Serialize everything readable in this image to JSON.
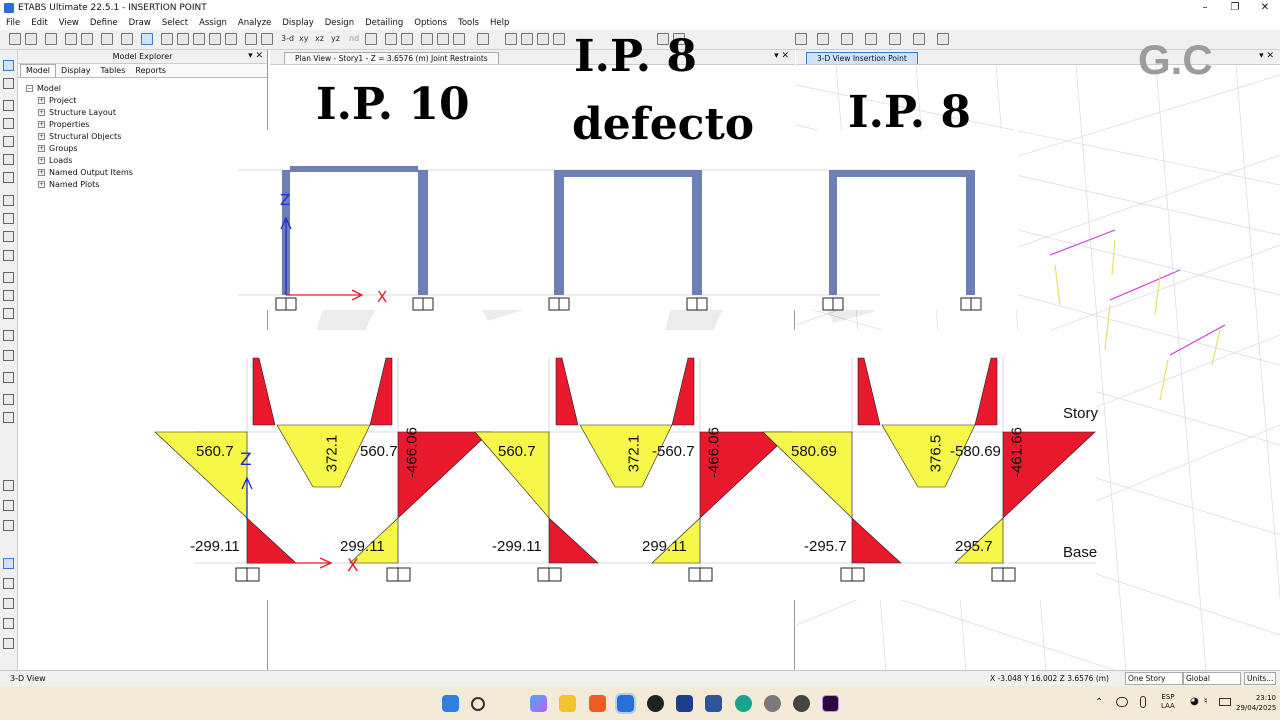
{
  "window": {
    "title": "ETABS Ultimate 22.5.1 - INSERTION POINT"
  },
  "menu": [
    "File",
    "Edit",
    "View",
    "Define",
    "Draw",
    "Select",
    "Assign",
    "Analyze",
    "Display",
    "Design",
    "Detailing",
    "Options",
    "Tools",
    "Help"
  ],
  "toolbar": {
    "view_3d_label": "3-d",
    "xy_label": "xy",
    "xz_label": "xz",
    "yz_label": "yz",
    "nd_label": "nd"
  },
  "explorer": {
    "title": "Model Explorer",
    "tabs": [
      "Model",
      "Display",
      "Tables",
      "Reports"
    ],
    "root": "Model",
    "items": [
      "Project",
      "Structure Layout",
      "Properties",
      "Structural Objects",
      "Groups",
      "Loads",
      "Named Output Items",
      "Named Plots"
    ]
  },
  "plan_view": {
    "tab": "Plan View - Story1 - Z = 3.6576 (m)  Joint Restraints"
  },
  "view3d": {
    "tab": "3-D View  Insertion Point"
  },
  "overlay": {
    "labels": {
      "ip10": "I.P. 10",
      "ip8a": "I.P. 8",
      "defecto": "defecto",
      "ip8b": "I.P. 8"
    },
    "axis": {
      "z": "Z",
      "x": "X"
    },
    "story": "Story",
    "base": "Base",
    "frame1": {
      "a": "560.7",
      "b": "372.1",
      "c": "560.7",
      "d": "-466.06",
      "e": "-299.11",
      "f": "299.11"
    },
    "frame2": {
      "a": "560.7",
      "b": "372.1",
      "c": "-560.7",
      "d": "-466.06",
      "e": "-299.11",
      "f": "299.11"
    },
    "frame3": {
      "a": "580.69",
      "b": "376.5",
      "c": "-580.69",
      "d": "-461.66",
      "e": "-295.7",
      "f": "295.7"
    }
  },
  "watermark": "G.C",
  "status": {
    "left": "3-D View",
    "coords": "X -3.048  Y 16.002  Z 3.6576 (m)",
    "story_sel": "One Story",
    "coord_sys": "Global",
    "units": "Units..."
  },
  "tray": {
    "lang": "ESP",
    "layout": "LAA",
    "time": "23:10",
    "date": "29/04/2025"
  },
  "colors": {
    "frame": "#6e7fb5",
    "moment_red": "#e8192c",
    "moment_yellow": "#f7f74a",
    "accent_blue": "#2a6fd6"
  },
  "icons": [
    "app-logo",
    "minimize-icon",
    "maximize-icon",
    "close-icon",
    "windows-start-icon",
    "search-icon",
    "copilot-icon",
    "file-explorer-icon",
    "brave-icon",
    "etabs-taskbar-icon",
    "obs-icon",
    "revit-icon",
    "word-icon",
    "edge-icon",
    "settings-icon",
    "headset-icon",
    "premiere-icon",
    "wifi-icon",
    "volume-icon",
    "battery-icon"
  ]
}
